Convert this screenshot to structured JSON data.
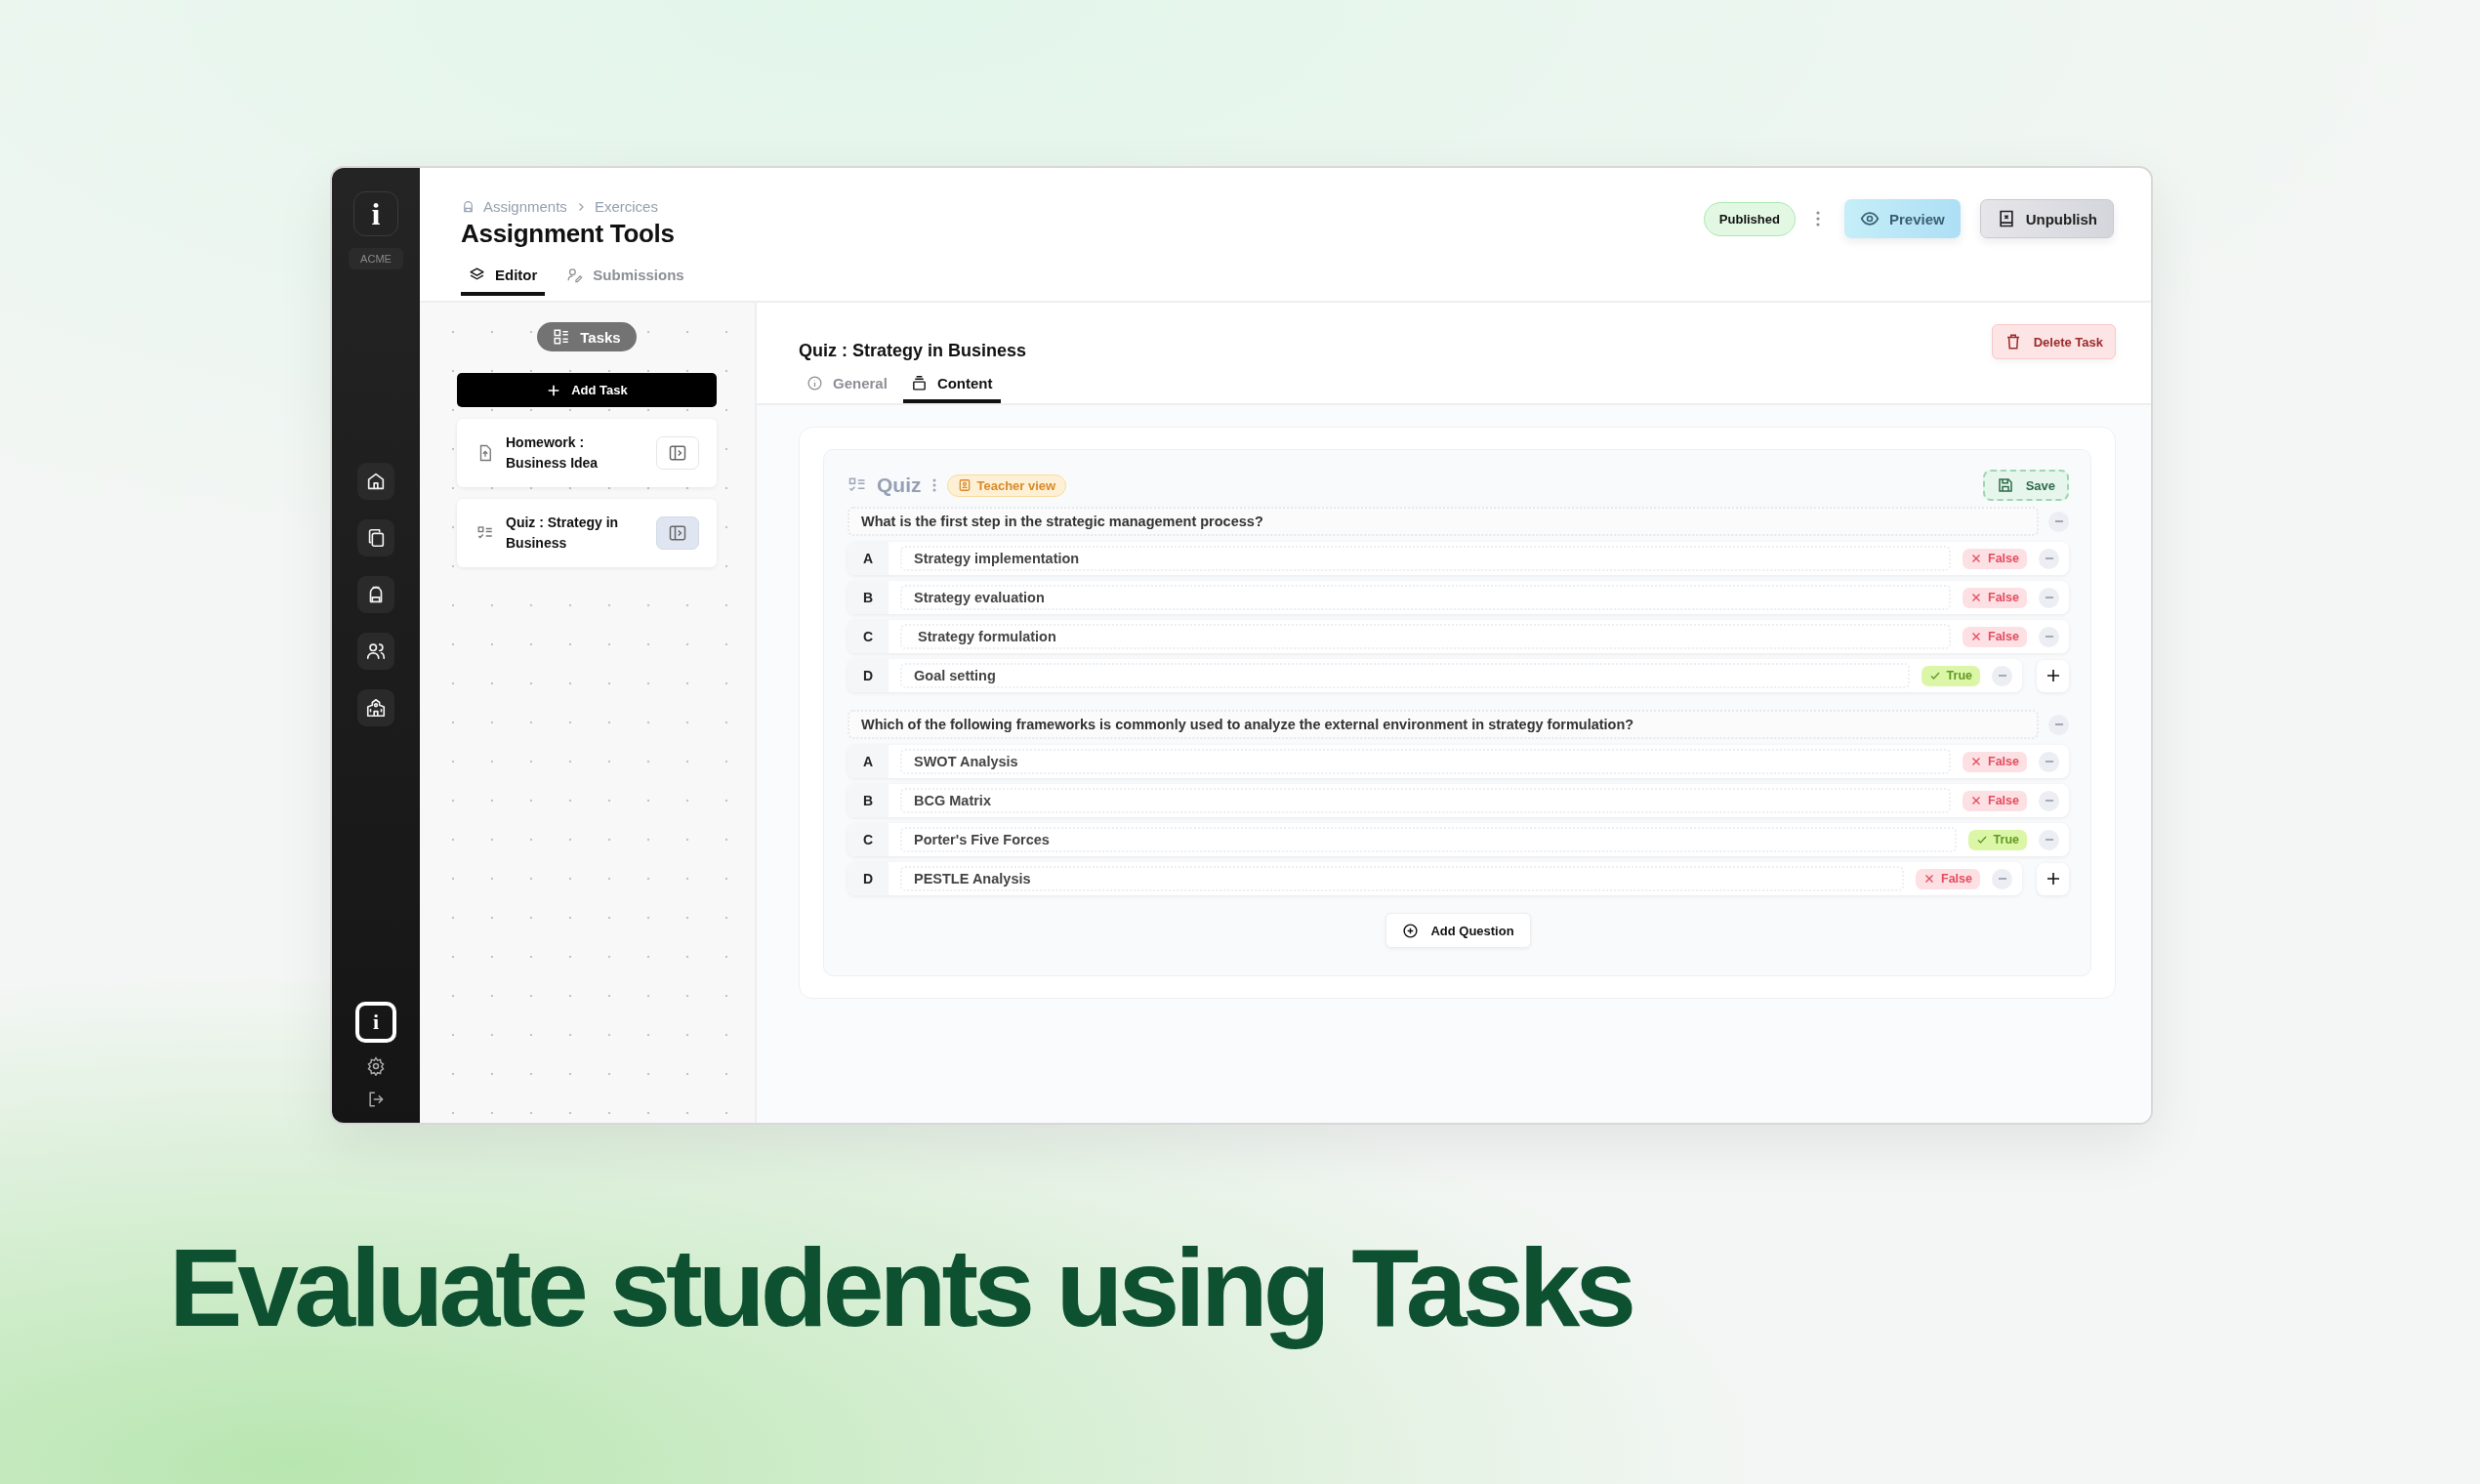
{
  "sidebar": {
    "logo": "i",
    "org": "ACME",
    "footer_logo": "i"
  },
  "header": {
    "breadcrumb": [
      "Assignments",
      "Exercices"
    ],
    "title": "Assignment Tools",
    "tabs": [
      {
        "label": "Editor",
        "kind": "editor",
        "selected": true
      },
      {
        "label": "Submissions",
        "kind": "submissions",
        "selected": false
      }
    ],
    "status": "Published",
    "actions": [
      {
        "label": "Preview",
        "kind": "preview"
      },
      {
        "label": "Unpublish",
        "kind": "unpublish"
      }
    ]
  },
  "tasks_panel": {
    "badge": "Tasks",
    "add_button": "Add Task",
    "tasks": [
      {
        "title": "Homework : Business Idea",
        "kind": "homework",
        "selected": false
      },
      {
        "title": "Quiz : Strategy in Business",
        "kind": "quiz",
        "selected": true
      }
    ]
  },
  "task": {
    "title": "Quiz : Strategy in Business",
    "delete_button": "Delete Task",
    "tabs": [
      {
        "label": "General",
        "kind": "general",
        "selected": false
      },
      {
        "label": "Content",
        "kind": "content",
        "selected": true
      }
    ],
    "quiz": {
      "heading": "Quiz",
      "view_badge": "Teacher view",
      "save_button": "Save",
      "questions": [
        {
          "text": "What is the first step in the strategic management process?",
          "answers": [
            {
              "letter": "A",
              "text": "Strategy implementation",
              "verdict": "False",
              "correct": false
            },
            {
              "letter": "B",
              "text": "Strategy evaluation",
              "verdict": "False",
              "correct": false
            },
            {
              "letter": "C",
              "text": " Strategy formulation",
              "verdict": "False",
              "correct": false
            },
            {
              "letter": "D",
              "text": "Goal setting",
              "verdict": "True",
              "correct": true
            }
          ]
        },
        {
          "text": "Which of the following frameworks is commonly used to analyze the external environment in strategy formulation?",
          "answers": [
            {
              "letter": "A",
              "text": "SWOT Analysis",
              "verdict": "False",
              "correct": false
            },
            {
              "letter": "B",
              "text": "BCG Matrix",
              "verdict": "False",
              "correct": false
            },
            {
              "letter": "C",
              "text": "Porter's Five Forces",
              "verdict": "True",
              "correct": true
            },
            {
              "letter": "D",
              "text": "PESTLE Analysis",
              "verdict": "False",
              "correct": false
            }
          ]
        }
      ],
      "add_question_button": "Add Question"
    }
  },
  "headline": "Evaluate students using Tasks"
}
